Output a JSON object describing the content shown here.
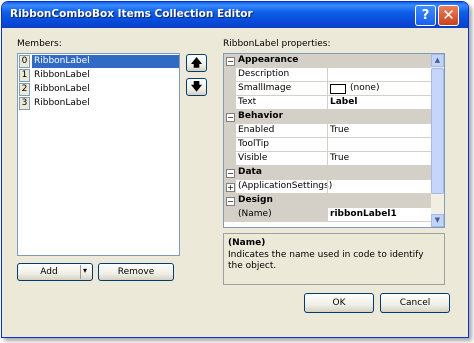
{
  "window": {
    "title": "RibbonComboBox Items Collection Editor",
    "help_glyph": "?",
    "close_glyph": "✕"
  },
  "members": {
    "label": "Members:",
    "items": [
      {
        "index": "0",
        "name": "RibbonLabel",
        "selected": true
      },
      {
        "index": "1",
        "name": "RibbonLabel",
        "selected": false
      },
      {
        "index": "2",
        "name": "RibbonLabel",
        "selected": false
      },
      {
        "index": "3",
        "name": "RibbonLabel",
        "selected": false
      }
    ],
    "up_glyph": "🡅",
    "down_glyph": "🡇",
    "add_label": "Add",
    "remove_label": "Remove"
  },
  "properties": {
    "label": "RibbonLabel properties:",
    "categories": {
      "appearance": "Appearance",
      "behavior": "Behavior",
      "data": "Data",
      "design": "Design"
    },
    "rows": {
      "description": {
        "name": "Description",
        "value": ""
      },
      "smallimage": {
        "name": "SmallImage",
        "value": "(none)"
      },
      "text": {
        "name": "Text",
        "value": "Label"
      },
      "enabled": {
        "name": "Enabled",
        "value": "True"
      },
      "tooltip": {
        "name": "ToolTip",
        "value": ""
      },
      "visible": {
        "name": "Visible",
        "value": "True"
      },
      "appsettings": {
        "name": "(ApplicationSettings)",
        "value": ""
      },
      "name": {
        "name": "(Name)",
        "value": "ribbonLabel1"
      }
    },
    "description_title": "(Name)",
    "description_text": "Indicates the name used in code to identify the object."
  },
  "footer": {
    "ok_label": "OK",
    "cancel_label": "Cancel"
  }
}
